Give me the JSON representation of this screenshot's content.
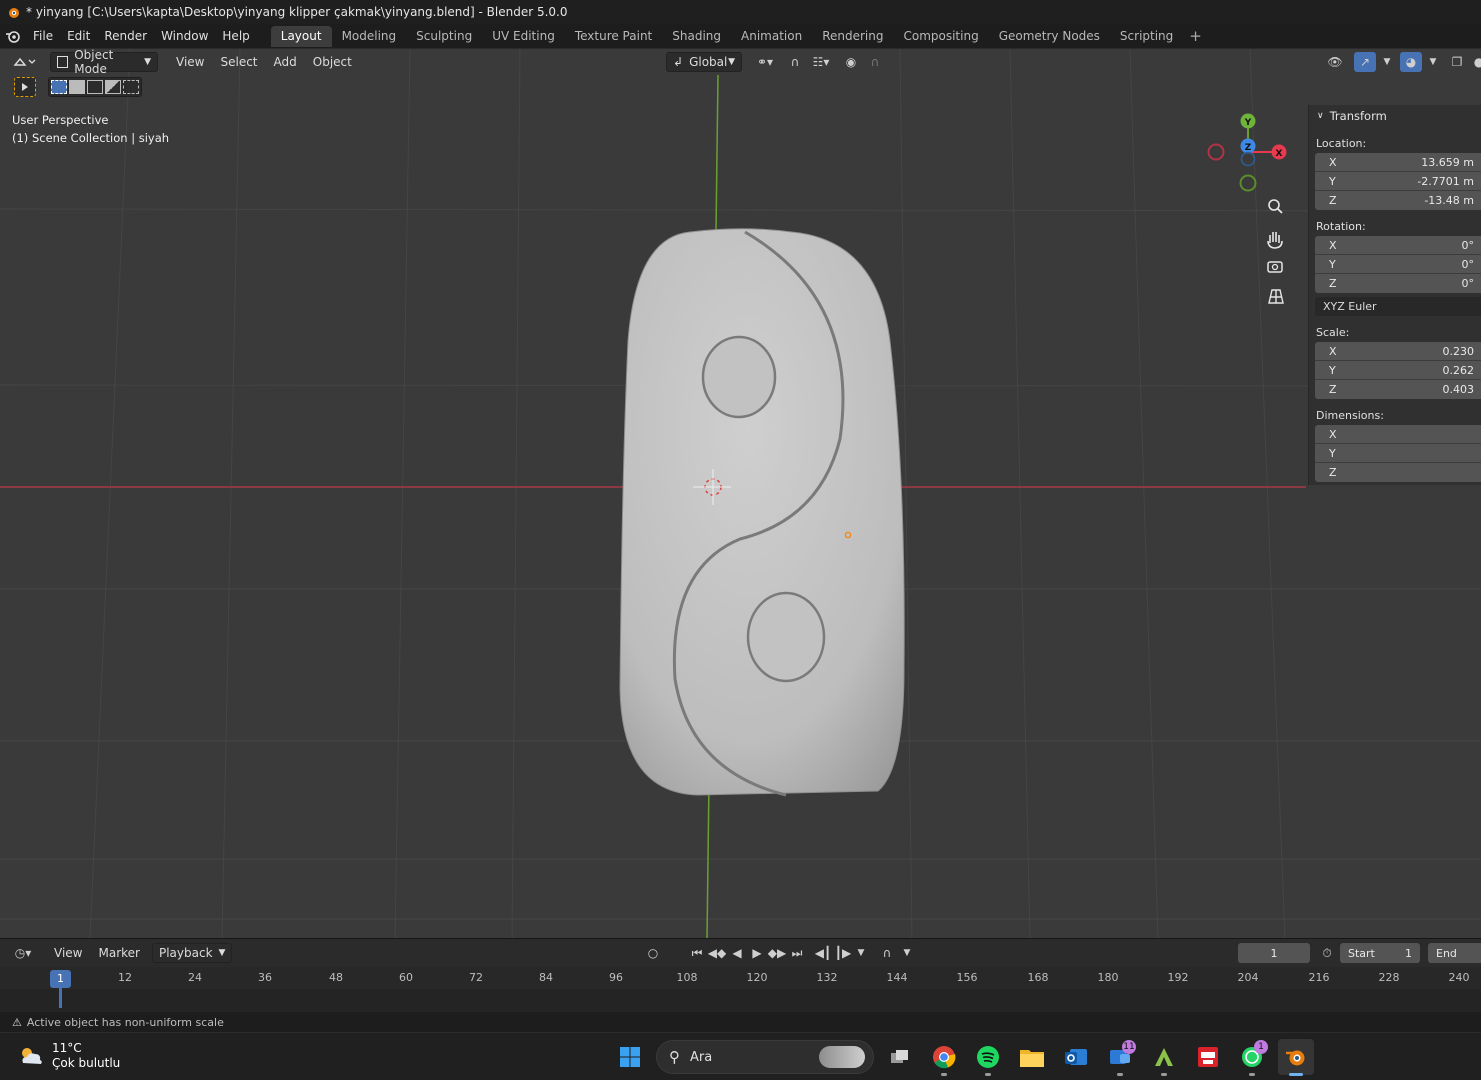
{
  "window": {
    "title": "* yinyang [C:\\Users\\kapta\\Desktop\\yinyang klipper çakmak\\yinyang.blend] - Blender 5.0.0"
  },
  "menu": {
    "items": [
      "File",
      "Edit",
      "Render",
      "Window",
      "Help"
    ]
  },
  "workspaces": {
    "tabs": [
      "Layout",
      "Modeling",
      "Sculpting",
      "UV Editing",
      "Texture Paint",
      "Shading",
      "Animation",
      "Rendering",
      "Compositing",
      "Geometry Nodes",
      "Scripting"
    ],
    "active": "Layout",
    "add": "+"
  },
  "viewport_header": {
    "mode": "Object Mode",
    "menus": [
      "View",
      "Select",
      "Add",
      "Object"
    ],
    "orientation": "Global"
  },
  "viewport": {
    "perspective": "User Perspective",
    "collection": "(1) Scene Collection | siyah",
    "gizmo": {
      "x": "X",
      "y": "Y",
      "z": "Z"
    }
  },
  "npanel": {
    "section": "Transform",
    "location_label": "Location:",
    "location": [
      {
        "axis": "X",
        "value": "13.659 m"
      },
      {
        "axis": "Y",
        "value": "-2.7701 m"
      },
      {
        "axis": "Z",
        "value": "-13.48 m"
      }
    ],
    "rotation_label": "Rotation:",
    "rotation": [
      {
        "axis": "X",
        "value": "0°"
      },
      {
        "axis": "Y",
        "value": "0°"
      },
      {
        "axis": "Z",
        "value": "0°"
      }
    ],
    "rotation_mode": "XYZ Euler",
    "scale_label": "Scale:",
    "scale": [
      {
        "axis": "X",
        "value": "0.230"
      },
      {
        "axis": "Y",
        "value": "0.262"
      },
      {
        "axis": "Z",
        "value": "0.403"
      }
    ],
    "dimensions_label": "Dimensions:",
    "dimensions": [
      {
        "axis": "X",
        "value": ""
      },
      {
        "axis": "Y",
        "value": ""
      },
      {
        "axis": "Z",
        "value": ""
      }
    ]
  },
  "timeline": {
    "menus": [
      "View",
      "Marker"
    ],
    "playback": "Playback",
    "current_frame": "1",
    "start_label": "Start",
    "start": "1",
    "end_label": "End",
    "frame_labels": [
      "1",
      "12",
      "24",
      "36",
      "48",
      "60",
      "72",
      "84",
      "96",
      "108",
      "120",
      "132",
      "144",
      "156",
      "168",
      "180",
      "192",
      "204",
      "216",
      "228",
      "240"
    ]
  },
  "status": {
    "warning": "Active object has non-uniform scale"
  },
  "taskbar": {
    "weather_temp": "11°C",
    "weather_desc": "Çok bulutlu",
    "search_placeholder": "Ara",
    "badge_mail": "11",
    "badge_whatsapp": "1"
  },
  "colors": {
    "accent": "#4772b3",
    "viewport_bg": "#3a3a3a",
    "axis_x": "#e83a4f",
    "axis_y": "#6fb43a",
    "axis_z": "#3d8ae6"
  }
}
